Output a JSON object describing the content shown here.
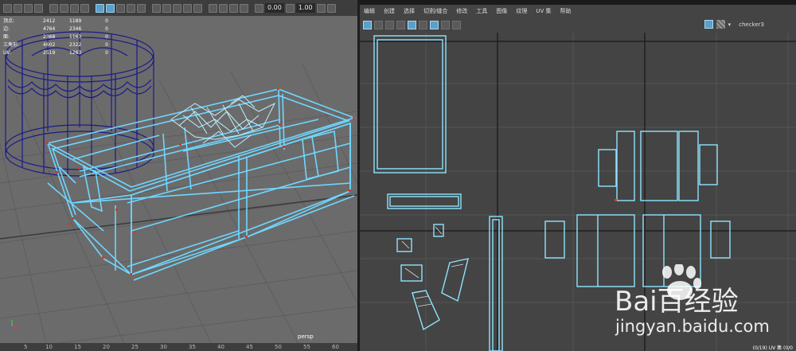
{
  "viewport": {
    "stats": [
      {
        "label": "顶点:",
        "v1": "2412",
        "v2": "1189",
        "v3": "0"
      },
      {
        "label": "边:",
        "v1": "4764",
        "v2": "2346",
        "v3": "0"
      },
      {
        "label": "面:",
        "v1": "2368",
        "v2": "1163",
        "v3": "0"
      },
      {
        "label": "三角形:",
        "v1": "4602",
        "v2": "2322",
        "v3": "0"
      },
      {
        "label": "UV:",
        "v1": "2519",
        "v2": "1263",
        "v3": "0"
      }
    ],
    "exposure": "0.00",
    "gamma": "1.00",
    "camera_label": "persp",
    "ruler_ticks": [
      "5",
      "10",
      "15",
      "20",
      "25",
      "30",
      "35",
      "40",
      "45",
      "50",
      "55",
      "60"
    ]
  },
  "uv_editor": {
    "menu": [
      "编辑",
      "创建",
      "选择",
      "切割/缝合",
      "修改",
      "工具",
      "图像",
      "纹理",
      "UV 集",
      "帮助"
    ],
    "texture_name": "checker3",
    "status": "(0/19) UV 集 (0/0"
  },
  "watermark": {
    "site": "jingyan.baidu.com",
    "logo_text": "Bai百经验"
  },
  "colors": {
    "wire_selected": "#6fd6ff",
    "wire_cylinder": "#1a1a8a",
    "viewport_bg": "#6b6b6b",
    "uv_bg": "#444444",
    "grid": "#555555"
  }
}
